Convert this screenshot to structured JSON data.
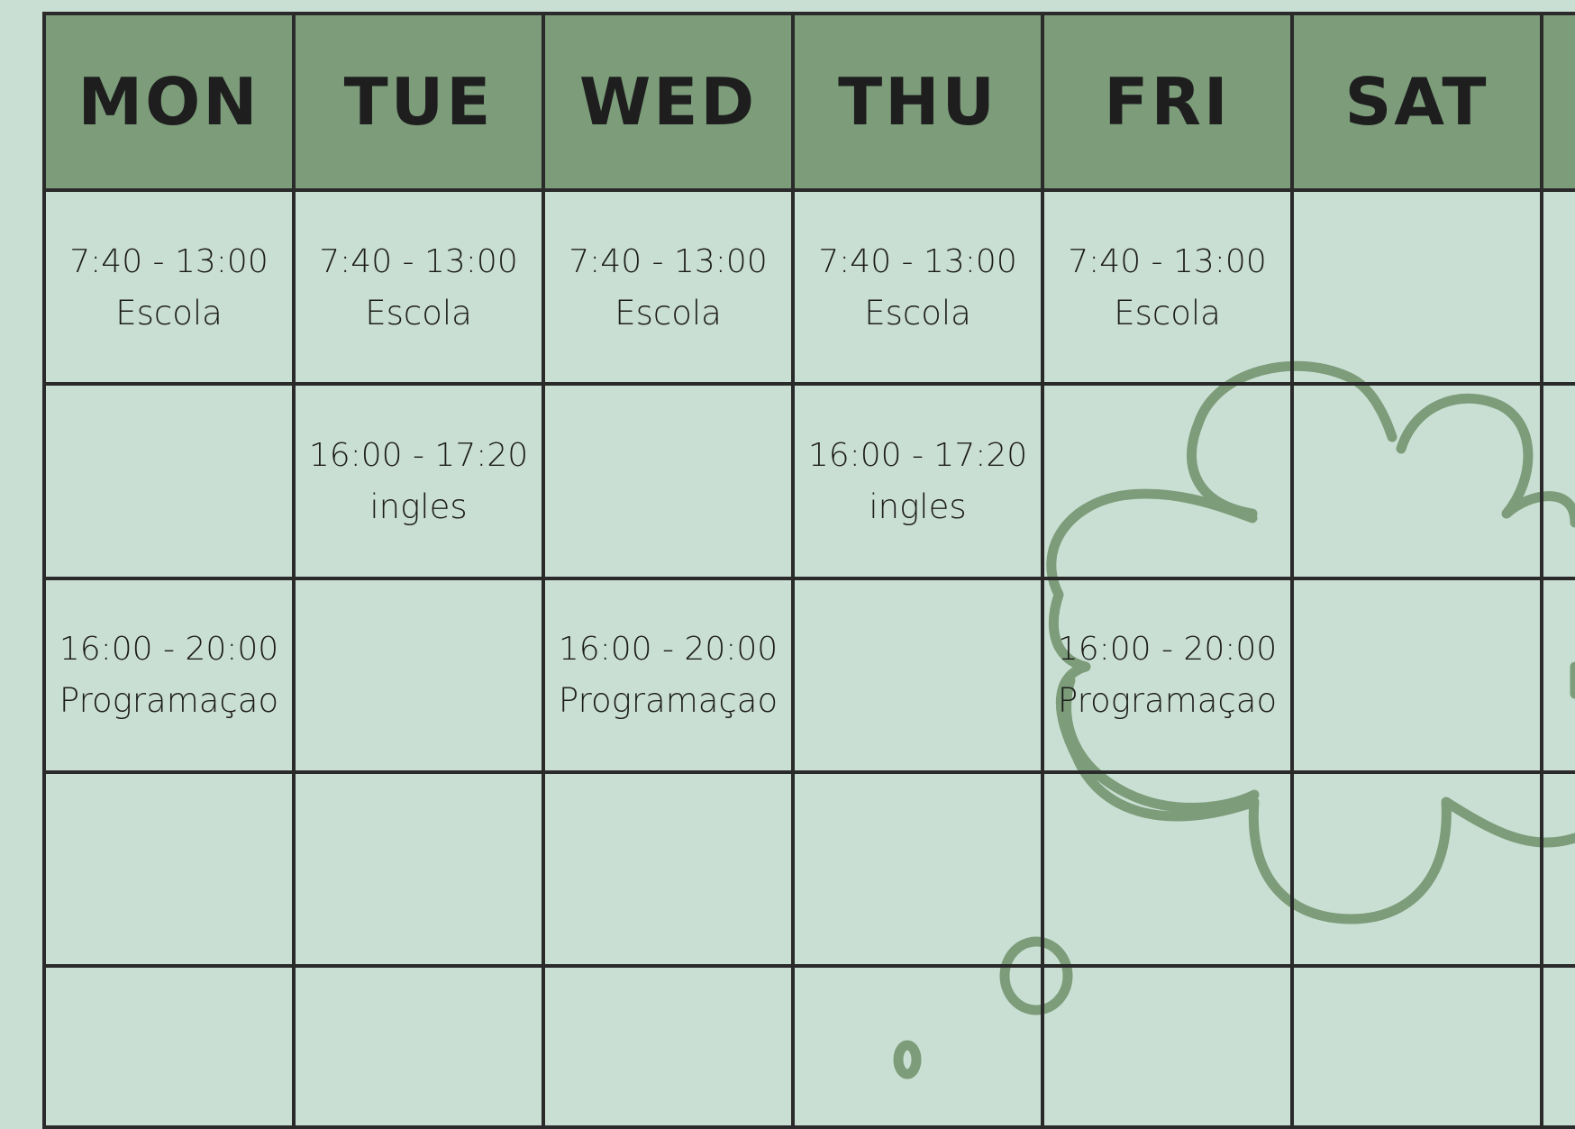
{
  "calendar": {
    "days": [
      "MON",
      "TUE",
      "WED",
      "THU",
      "FRI",
      "SAT"
    ],
    "rows": [
      [
        {
          "time": "7:40 - 13:00",
          "name": "Escola"
        },
        {
          "time": "7:40 - 13:00",
          "name": "Escola"
        },
        {
          "time": "7:40 - 13:00",
          "name": "Escola"
        },
        {
          "time": "7:40 - 13:00",
          "name": "Escola"
        },
        {
          "time": "7:40 - 13:00",
          "name": "Escola"
        },
        null
      ],
      [
        null,
        {
          "time": "16:00 - 17:20",
          "name": "ingles"
        },
        null,
        {
          "time": "16:00 - 17:20",
          "name": "ingles"
        },
        null,
        null
      ],
      [
        {
          "time": "16:00 - 20:00",
          "name": "Programaçao"
        },
        null,
        {
          "time": "16:00 - 20:00",
          "name": "Programaçao"
        },
        null,
        {
          "time": "16:00 - 20:00",
          "name": "Programaçao"
        },
        null
      ],
      [
        null,
        null,
        null,
        null,
        null,
        null
      ],
      [
        null,
        null,
        null,
        null,
        null,
        null
      ]
    ]
  },
  "colors": {
    "background": "#cadfd3",
    "header": "#7c9c7a",
    "grid_line": "#2a2a2a",
    "doodle": "#7c9c7a"
  },
  "decorations": [
    "flower-doodle",
    "small-circle-doodle",
    "tiny-circle-doodle"
  ]
}
